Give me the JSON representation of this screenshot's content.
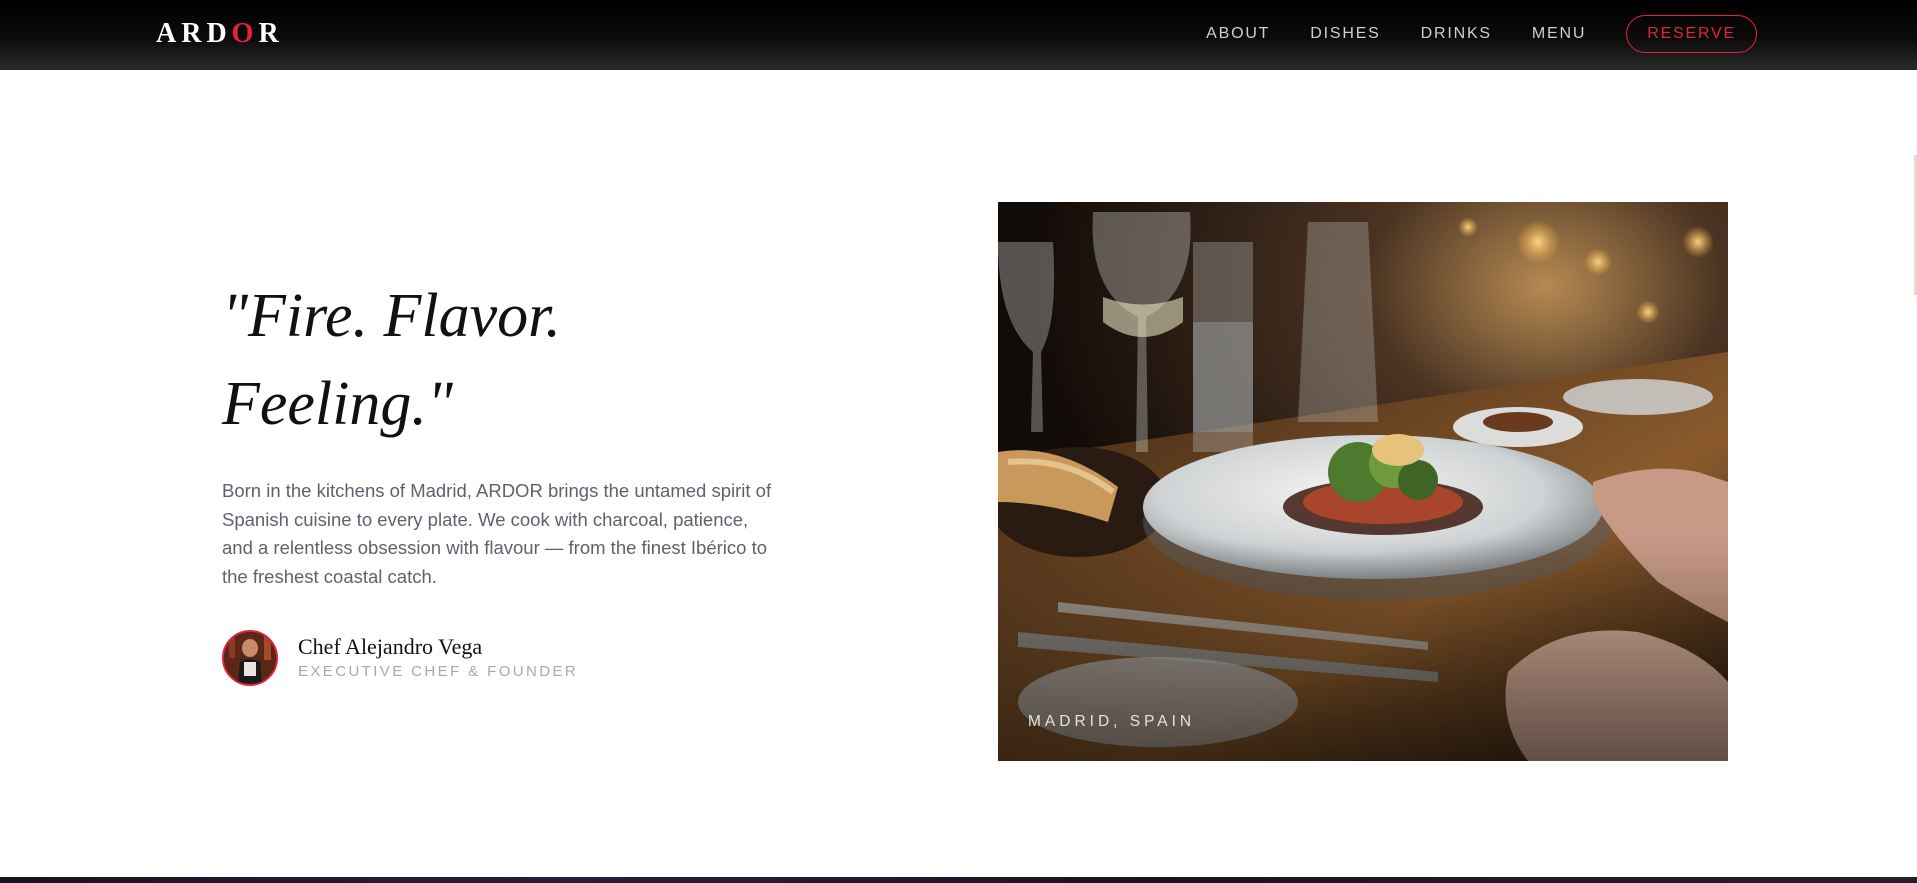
{
  "header": {
    "logo": {
      "before": "ARD",
      "accent": "O",
      "after": "R",
      "accent_color": "#e3233a"
    },
    "nav": [
      {
        "label": "ABOUT"
      },
      {
        "label": "DISHES"
      },
      {
        "label": "DRINKS"
      },
      {
        "label": "MENU"
      }
    ],
    "reserve_label": "RESERVE"
  },
  "hero": {
    "quote_line1": "\"Fire. Flavor.",
    "quote_line2": "Feeling.\"",
    "body": "Born in the kitchens of Madrid, ARDOR brings the untamed spirit of Spanish cuisine to every plate. We cook with charcoal, patience, and a relentless obsession with flavour — from the finest Ibérico to the freshest coastal catch.",
    "chef": {
      "name": "Chef Alejandro Vega",
      "role": "EXECUTIVE CHEF & FOUNDER"
    },
    "photo_caption": "MADRID, SPAIN"
  },
  "colors": {
    "accent": "#e3233a",
    "header_bg": "#000000",
    "body_text": "#5c6270",
    "muted_text": "#a4a9b4"
  }
}
